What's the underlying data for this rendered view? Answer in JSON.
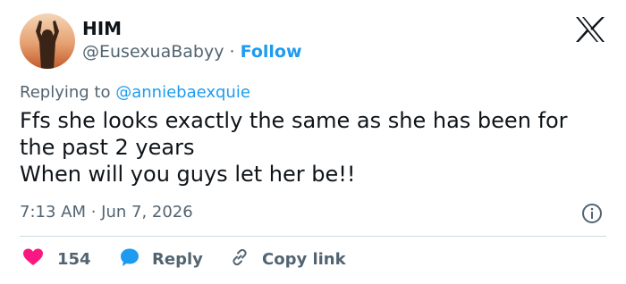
{
  "author": {
    "name": "HIM",
    "handle": "@EusexuaBabyy",
    "separator": "·",
    "follow_label": "Follow"
  },
  "brand": {
    "logo_icon": "x-logo-icon"
  },
  "tweet": {
    "replying_prefix": "Replying to",
    "replying_to": "@anniebaexquie",
    "text_lines": [
      "Ffs she looks exactly the same as she has been for",
      "the past 2 years",
      "When will you guys let her be!!"
    ],
    "timestamp": "7:13 AM · Jun 7, 2026"
  },
  "actions": {
    "like_count": "154",
    "reply_label": "Reply",
    "copy_label": "Copy link"
  },
  "colors": {
    "accent": "#1d9bf0",
    "like": "#f91880",
    "text": "#0f1419",
    "muted": "#536471"
  }
}
